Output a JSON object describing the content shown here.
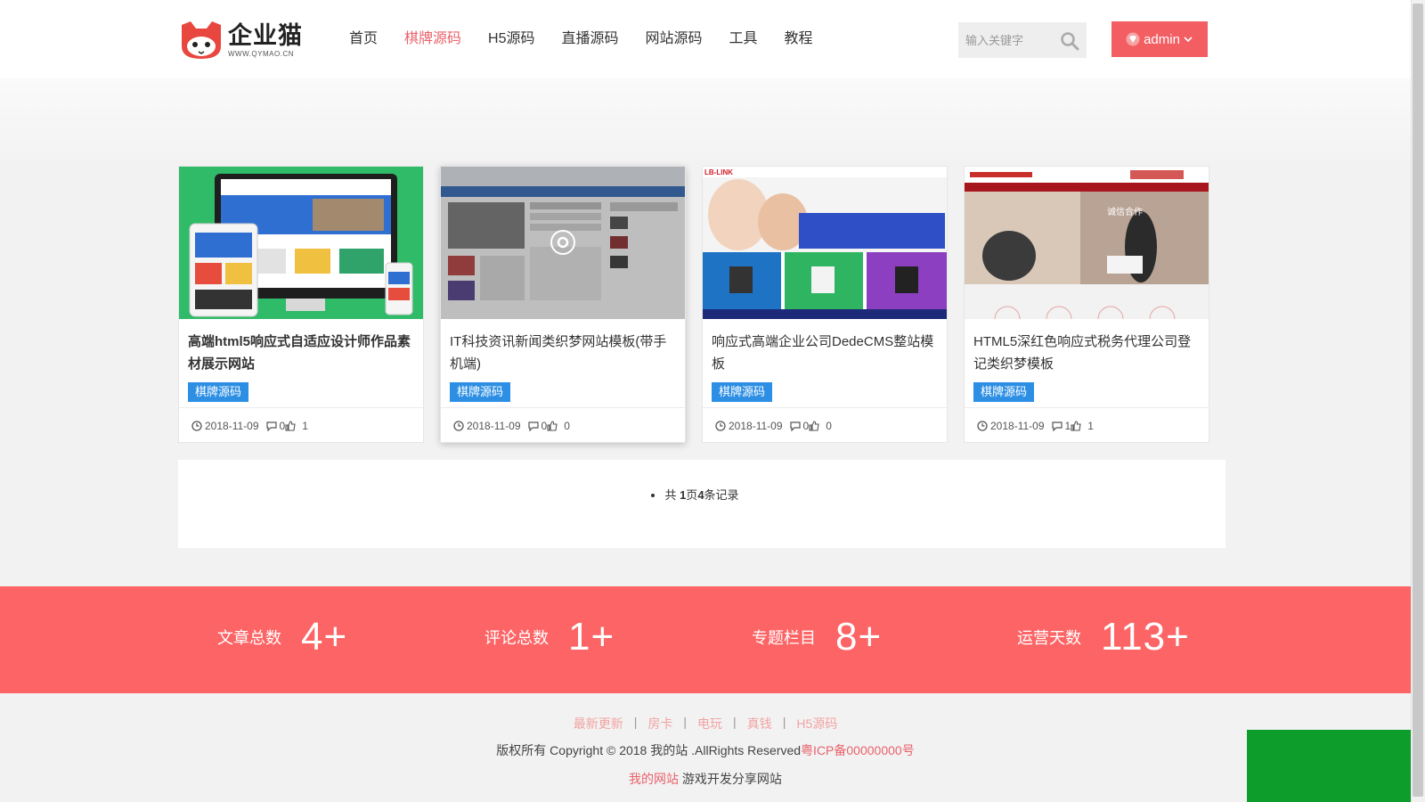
{
  "logo": {
    "name": "企业猫",
    "sub": "WWW.QYMAO.CN"
  },
  "nav": [
    {
      "label": "首页",
      "active": false
    },
    {
      "label": "棋牌源码",
      "active": true
    },
    {
      "label": "H5源码",
      "active": false
    },
    {
      "label": "直播源码",
      "active": false
    },
    {
      "label": "网站源码",
      "active": false
    },
    {
      "label": "工具",
      "active": false
    },
    {
      "label": "教程",
      "active": false
    }
  ],
  "search": {
    "placeholder": "输入关键字"
  },
  "user": {
    "label": "admin"
  },
  "cards": [
    {
      "title": "高端html5响应式自适应设计师作品素材展示网站",
      "tag": "棋牌源码",
      "date": "2018-11-09",
      "comments": "0",
      "likes": "1"
    },
    {
      "title": "IT科技资讯新闻类织梦网站模板(带手机端)",
      "tag": "棋牌源码",
      "date": "2018-11-09",
      "comments": "0",
      "likes": "0"
    },
    {
      "title": "响应式高端企业公司DedeCMS整站模板",
      "tag": "棋牌源码",
      "date": "2018-11-09",
      "comments": "0",
      "likes": "0"
    },
    {
      "title": "HTML5深红色响应式税务代理公司登记类织梦模板",
      "tag": "棋牌源码",
      "date": "2018-11-09",
      "comments": "1",
      "likes": "1"
    }
  ],
  "pager": {
    "prefix": "共 ",
    "pages": "1",
    "mid": "页",
    "count": "4",
    "suffix": "条记录"
  },
  "stats": [
    {
      "label": "文章总数",
      "value": "4+"
    },
    {
      "label": "评论总数",
      "value": "1+"
    },
    {
      "label": "专题栏目",
      "value": "8+"
    },
    {
      "label": "运营天数",
      "value": "113+"
    }
  ],
  "footer": {
    "links": [
      "最新更新",
      "房卡",
      "电玩",
      "真钱",
      "H5源码"
    ],
    "copyright": "版权所有 Copyright © 2018 我的站 .AllRights Reserved",
    "icp": "粤ICP备00000000号",
    "site_name": "我的网站",
    "site_desc": " 游戏开发分享网站"
  },
  "colors": {
    "accent": "#e9626b",
    "stats_bg": "#fd6465",
    "tag_bg": "#2d8fe4",
    "admin_bg": "#f25e62"
  }
}
